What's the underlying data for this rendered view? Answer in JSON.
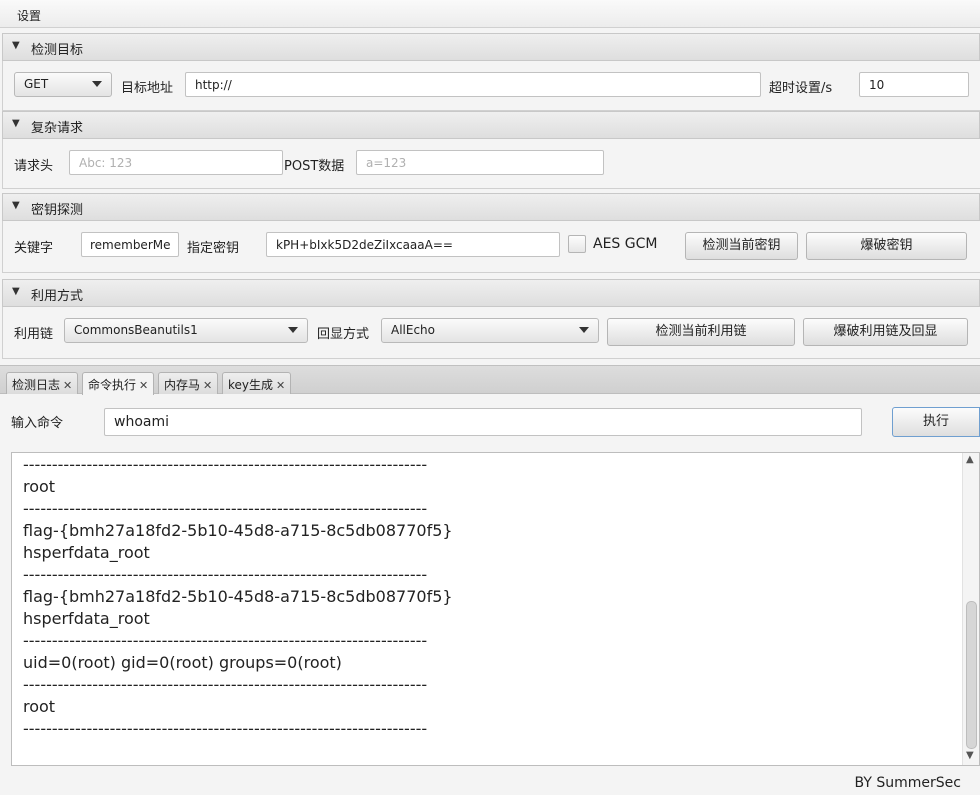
{
  "menu": {
    "settings": "设置"
  },
  "sections": {
    "target": {
      "title": "检测目标",
      "method": "GET",
      "url_label": "目标地址",
      "url_value": "http://",
      "timeout_label": "超时设置/s",
      "timeout_value": "10"
    },
    "complex": {
      "title": "复杂请求",
      "header_label": "请求头",
      "header_placeholder": "Abc: 123",
      "post_label": "POST数据",
      "post_placeholder": "a=123"
    },
    "key": {
      "title": "密钥探测",
      "keyword_label": "关键字",
      "keyword_value": "rememberMe",
      "key_label": "指定密钥",
      "key_value": "kPH+bIxk5D2deZiIxcaaaA==",
      "aes_gcm_label": "AES GCM",
      "check_button": "检测当前密钥",
      "brute_button": "爆破密钥"
    },
    "exploit": {
      "title": "利用方式",
      "chain_label": "利用链",
      "chain_value": "CommonsBeanutils1",
      "echo_label": "回显方式",
      "echo_value": "AllEcho",
      "check_button": "检测当前利用链",
      "brute_button": "爆破利用链及回显"
    }
  },
  "tabs": [
    {
      "label": "检测日志",
      "close": "✕"
    },
    {
      "label": "命令执行",
      "close": "✕"
    },
    {
      "label": "内存马",
      "close": "✕"
    },
    {
      "label": "key生成",
      "close": "✕"
    }
  ],
  "command": {
    "label": "输入命令",
    "value": "whoami",
    "execute_button": "执行"
  },
  "output_lines": [
    "----------------------------------------------------------------------",
    "root",
    "----------------------------------------------------------------------",
    "flag-{bmh27a18fd2-5b10-45d8-a715-8c5db08770f5}",
    "hsperfdata_root",
    "----------------------------------------------------------------------",
    "flag-{bmh27a18fd2-5b10-45d8-a715-8c5db08770f5}",
    "hsperfdata_root",
    "----------------------------------------------------------------------",
    "uid=0(root) gid=0(root) groups=0(root)",
    "----------------------------------------------------------------------",
    "root",
    "----------------------------------------------------------------------"
  ],
  "scroll": {
    "up": "▲",
    "down": "▼"
  },
  "footer": {
    "credit": "BY   SummerSec"
  },
  "icons": {
    "collapse": "triangle-down-icon",
    "close": "close-icon"
  },
  "colors": {
    "accent_border": "#6f9fd0",
    "background": "#f4f4f4"
  }
}
